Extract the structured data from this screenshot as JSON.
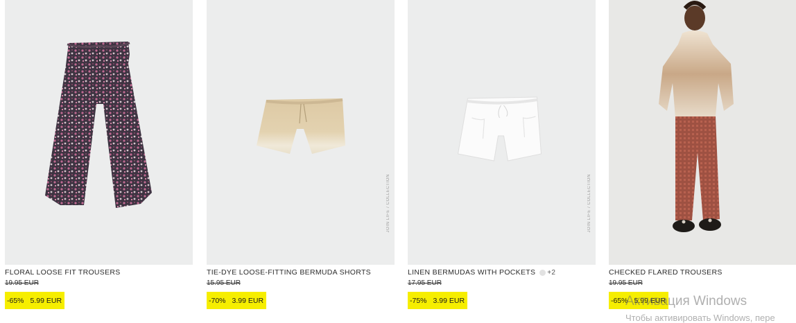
{
  "products": [
    {
      "name": "FLORAL LOOSE FIT TROUSERS",
      "old_price": "19.95 EUR",
      "discount": "-65%",
      "price": "5.99 EUR",
      "image": "floral-trousers"
    },
    {
      "name": "TIE-DYE LOOSE-FITTING BERMUDA SHORTS",
      "old_price": "15.95 EUR",
      "discount": "-70%",
      "price": "3.99 EUR",
      "side_label": "JOIN LIFE / COLLECTION",
      "image": "tie-dye-shorts"
    },
    {
      "name": "LINEN BERMUDAS WITH POCKETS",
      "color_more": "+2",
      "old_price": "17.95 EUR",
      "discount": "-75%",
      "price": "3.99 EUR",
      "side_label": "JOIN LIFE / COLLECTION",
      "image": "linen-bermudas"
    },
    {
      "name": "CHECKED FLARED TROUSERS",
      "old_price": "19.95 EUR",
      "discount": "-65%",
      "price": "5.99 EUR",
      "image": "checked-trousers-model"
    }
  ],
  "watermark": {
    "title": "Активация Windows",
    "subtitle": "Чтобы активировать Windows, пере"
  },
  "colors": {
    "sale_highlight": "#f6ee00",
    "photo_bg": "#eceded"
  }
}
